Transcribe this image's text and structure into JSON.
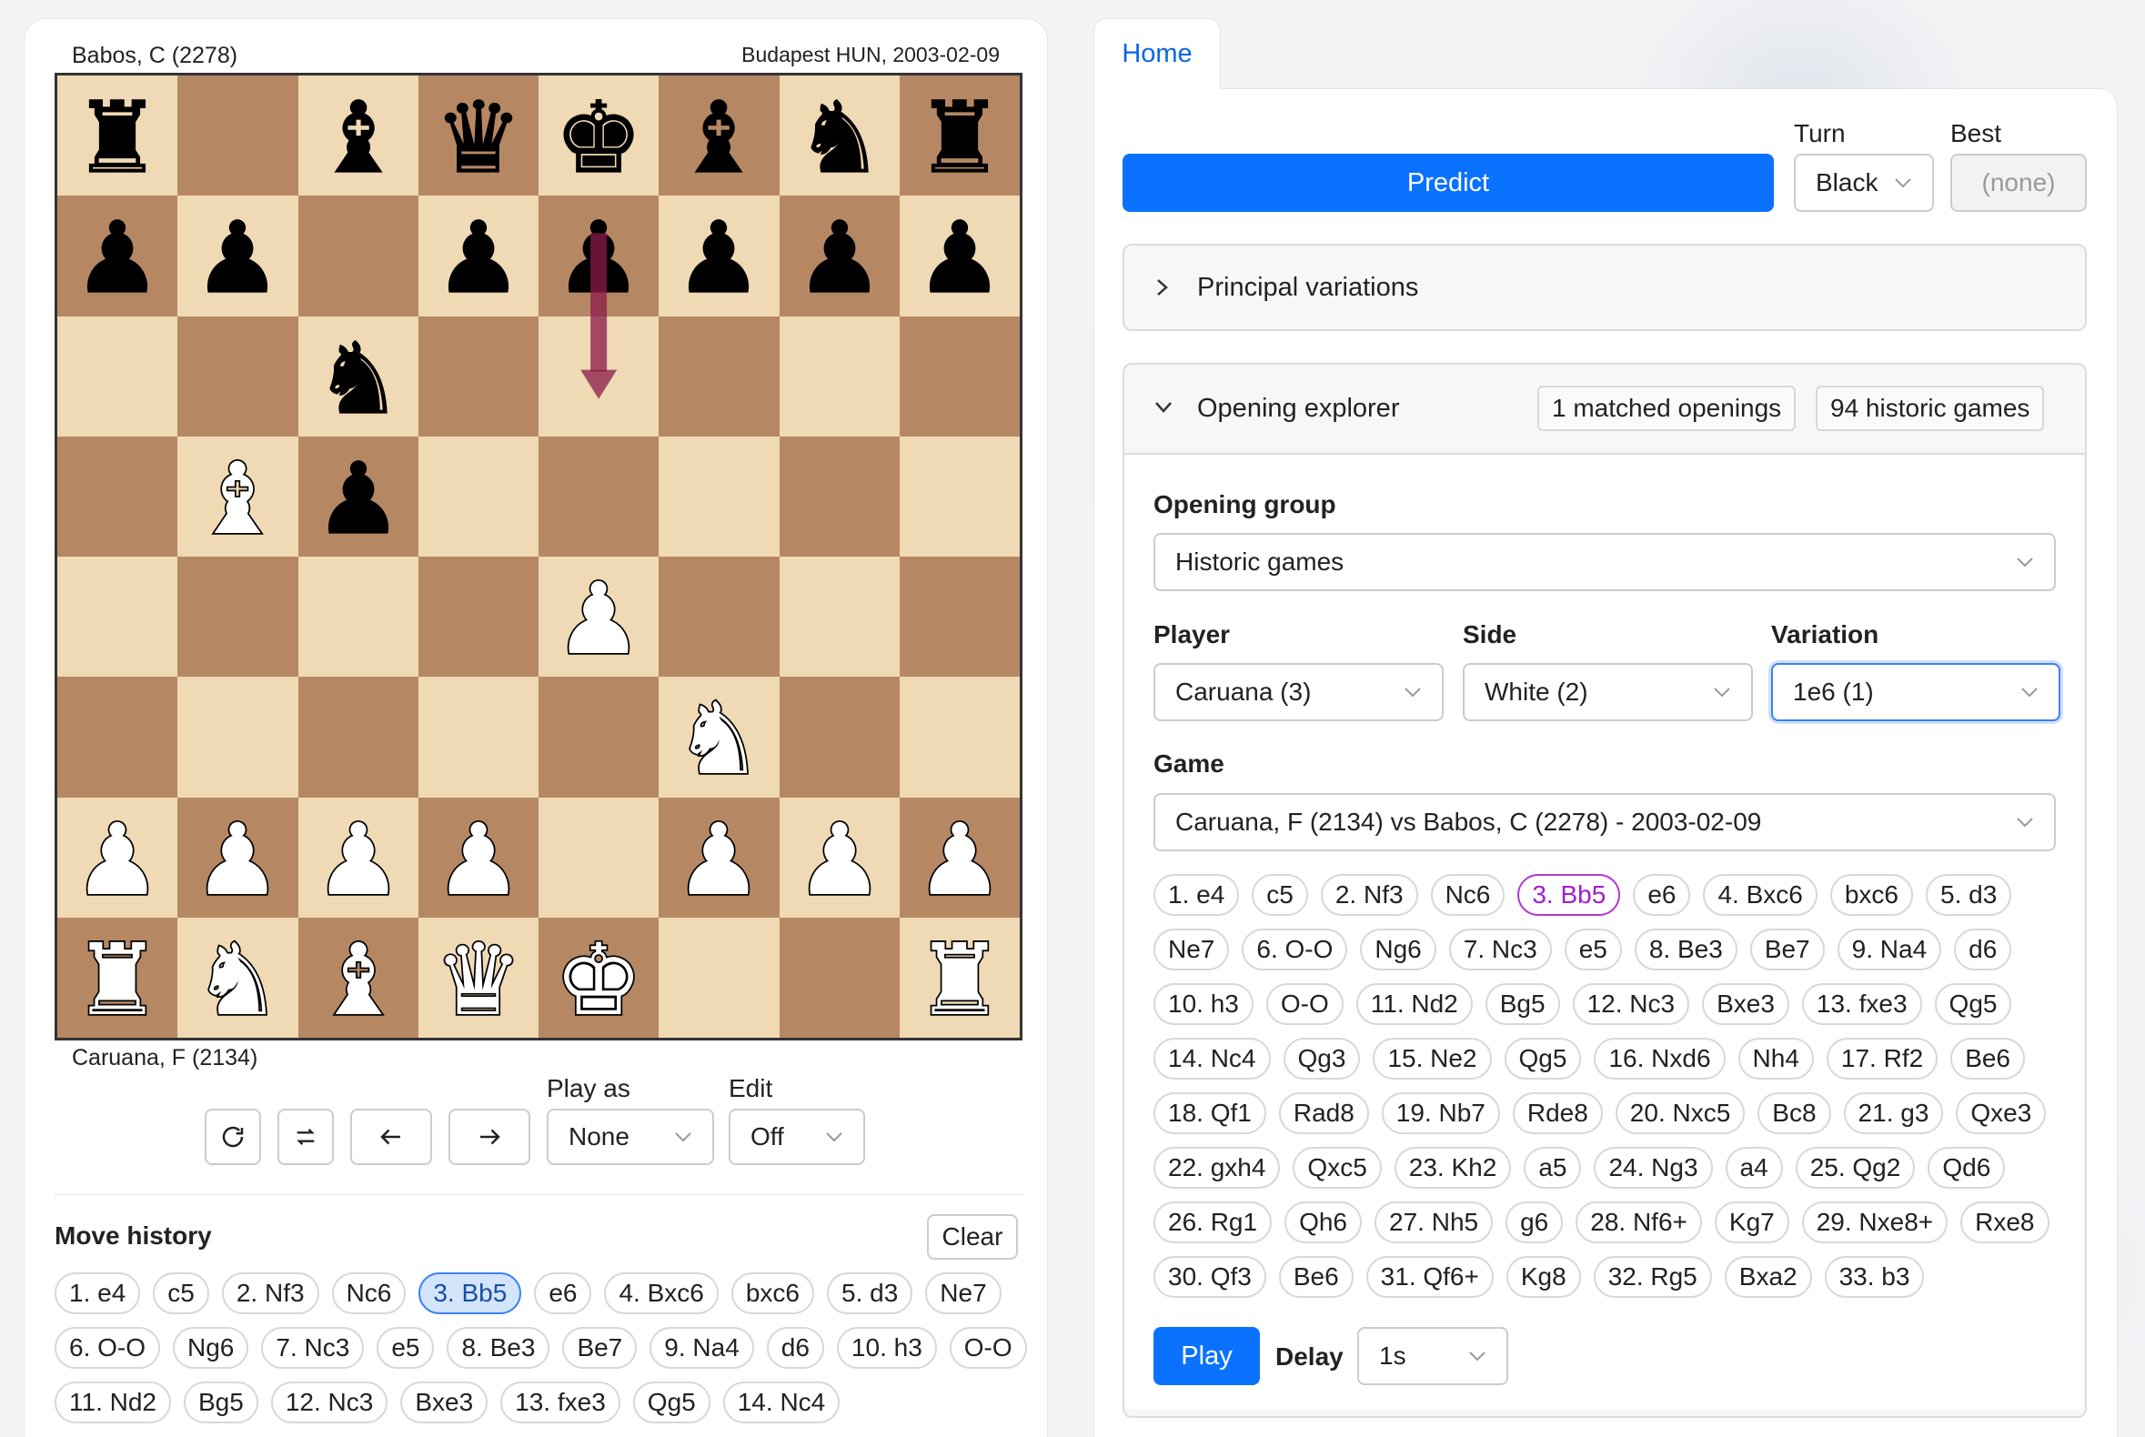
{
  "left": {
    "player_top": "Babos, C (2278)",
    "event": "Budapest HUN, 2003-02-09",
    "player_bottom": "Caruana, F (2134)",
    "play_as_label": "Play as",
    "play_as_value": "None",
    "edit_label": "Edit",
    "edit_value": "Off",
    "move_history_title": "Move history",
    "clear_label": "Clear",
    "moves": [
      "1. e4",
      "c5",
      "2. Nf3",
      "Nc6",
      "3. Bb5",
      "e6",
      "4. Bxc6",
      "bxc6",
      "5. d3",
      "Ne7",
      "6. O-O",
      "Ng6",
      "7. Nc3",
      "e5",
      "8. Be3",
      "Be7",
      "9. Na4",
      "d6",
      "10. h3",
      "O-O",
      "11. Nd2",
      "Bg5",
      "12. Nc3",
      "Bxe3",
      "13. fxe3",
      "Qg5",
      "14. Nc4"
    ],
    "active_move_index": 4
  },
  "board": {
    "rows": [
      [
        "bR",
        "",
        "bB",
        "bQ",
        "bK",
        "bB",
        "bN",
        "bR"
      ],
      [
        "bP",
        "bP",
        "",
        "bP",
        "bP",
        "bP",
        "bP",
        "bP"
      ],
      [
        "",
        "",
        "bN",
        "",
        "",
        "",
        "",
        ""
      ],
      [
        "",
        "wB",
        "bP",
        "",
        "",
        "",
        "",
        ""
      ],
      [
        "",
        "",
        "",
        "",
        "wP",
        "",
        "",
        ""
      ],
      [
        "",
        "",
        "",
        "",
        "",
        "wN",
        "",
        ""
      ],
      [
        "wP",
        "wP",
        "wP",
        "wP",
        "",
        "wP",
        "wP",
        "wP"
      ],
      [
        "wR",
        "wN",
        "wB",
        "wQ",
        "wK",
        "",
        "",
        "wR"
      ]
    ],
    "arrow": {
      "from": "e7",
      "to": "e6",
      "color": "#8b1a4a"
    }
  },
  "right": {
    "tab_home": "Home",
    "predict_label": "Predict",
    "turn_label": "Turn",
    "turn_value": "Black",
    "best_label": "Best",
    "best_value": "(none)",
    "pv_title": "Principal variations",
    "explorer_title": "Opening explorer",
    "matched_badge": "1 matched openings",
    "historic_badge": "94 historic games",
    "opening_group_label": "Opening group",
    "opening_group_value": "Historic games",
    "player_label": "Player",
    "player_value": "Caruana (3)",
    "side_label": "Side",
    "side_value": "White (2)",
    "variation_label": "Variation",
    "variation_value": "1e6 (1)",
    "game_label": "Game",
    "game_value": "Caruana, F (2134) vs Babos, C (2278) - 2003-02-09",
    "moves": [
      "1. e4",
      "c5",
      "2. Nf3",
      "Nc6",
      "3. Bb5",
      "e6",
      "4. Bxc6",
      "bxc6",
      "5. d3",
      "Ne7",
      "6. O-O",
      "Ng6",
      "7. Nc3",
      "e5",
      "8. Be3",
      "Be7",
      "9. Na4",
      "d6",
      "10. h3",
      "O-O",
      "11. Nd2",
      "Bg5",
      "12. Nc3",
      "Bxe3",
      "13. fxe3",
      "Qg5",
      "14. Nc4",
      "Qg3",
      "15. Ne2",
      "Qg5",
      "16. Nxd6",
      "Nh4",
      "17. Rf2",
      "Be6",
      "18. Qf1",
      "Rad8",
      "19. Nb7",
      "Rde8",
      "20. Nxc5",
      "Bc8",
      "21. g3",
      "Qxe3",
      "22. gxh4",
      "Qxc5",
      "23. Kh2",
      "a5",
      "24. Ng3",
      "a4",
      "25. Qg2",
      "Qd6",
      "26. Rg1",
      "Qh6",
      "27. Nh5",
      "g6",
      "28. Nf6+",
      "Kg7",
      "29. Nxe8+",
      "Rxe8",
      "30. Qf3",
      "Be6",
      "31. Qf6+",
      "Kg8",
      "32. Rg5",
      "Bxa2",
      "33. b3"
    ],
    "active_move_index": 4,
    "play_label": "Play",
    "delay_label": "Delay",
    "delay_value": "1s"
  }
}
